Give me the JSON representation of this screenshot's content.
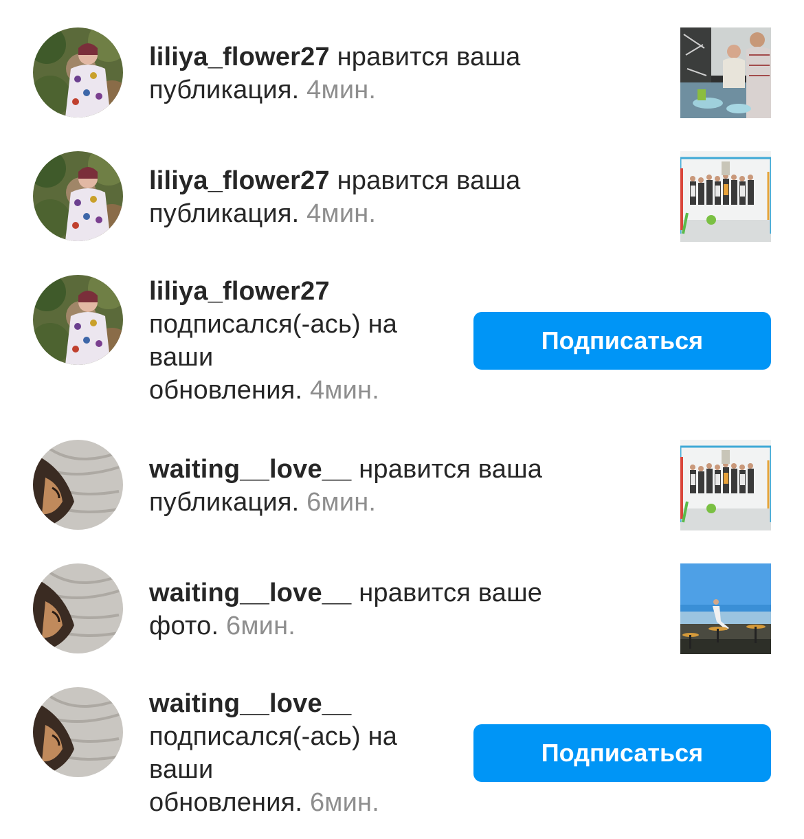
{
  "notifications": [
    {
      "username": "liliya_flower27",
      "action_line1": " нравится ваша",
      "action_line2": "публикация.",
      "time": "4мин.",
      "avatar_icon": "avatar-liliya-photo",
      "thumbnail_icon": "post-kitchen-couple-photo"
    },
    {
      "username": "liliya_flower27",
      "action_line1": " нравится ваша",
      "action_line2": "публикация.",
      "time": "4мин.",
      "avatar_icon": "avatar-liliya-photo",
      "thumbnail_icon": "post-group-photo"
    },
    {
      "username": "liliya_flower27",
      "action_lines": [
        "подписался(-ась) на",
        "ваши",
        "обновления."
      ],
      "time": "4мин.",
      "avatar_icon": "avatar-liliya-photo",
      "button_label": "Подписаться"
    },
    {
      "username": "waiting__love__",
      "action_line1": " нравится ваша",
      "action_line2": "публикация.",
      "time": "6мин.",
      "avatar_icon": "avatar-waiting-love-photo",
      "thumbnail_icon": "post-group-photo"
    },
    {
      "username": "waiting__love__",
      "action_line1": " нравится ваше",
      "action_line2": "фото.",
      "time": "6мин.",
      "avatar_icon": "avatar-waiting-love-photo",
      "thumbnail_icon": "post-seaside-photo"
    },
    {
      "username": "waiting__love__",
      "action_lines": [
        "подписался(-ась) на",
        "ваши",
        "обновления."
      ],
      "time": "6мин.",
      "avatar_icon": "avatar-waiting-love-photo",
      "button_label": "Подписаться"
    }
  ],
  "colors": {
    "accent": "#0095f6",
    "text": "#262626",
    "secondary_text": "#8e8e8e",
    "background": "#ffffff"
  }
}
